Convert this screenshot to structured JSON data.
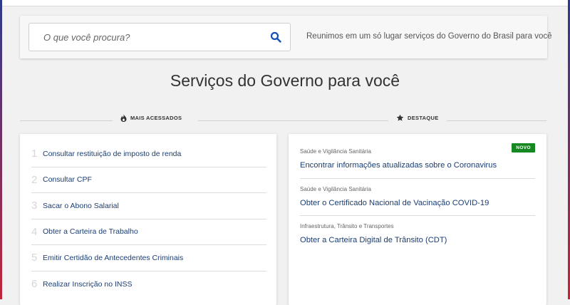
{
  "search": {
    "placeholder": "O que você procura?",
    "tagline": "Reunimos em um só lugar serviços do Governo do Brasil para você"
  },
  "main": {
    "title": "Serviços do Governo para você"
  },
  "most_accessed": {
    "heading": "MAIS ACESSADOS",
    "icon": "flame-icon",
    "items": [
      {
        "rank": "1",
        "label": "Consultar restituição de imposto de renda"
      },
      {
        "rank": "2",
        "label": "Consultar CPF"
      },
      {
        "rank": "3",
        "label": "Sacar o Abono Salarial"
      },
      {
        "rank": "4",
        "label": "Obter a Carteira de Trabalho"
      },
      {
        "rank": "5",
        "label": "Emitir Certidão de Antecedentes Criminais"
      },
      {
        "rank": "6",
        "label": "Realizar Inscrição no INSS"
      }
    ]
  },
  "highlights": {
    "heading": "DESTAQUE",
    "icon": "star-icon",
    "items": [
      {
        "category": "Saúde e Vigilância Sanitária",
        "title": "Encontrar informações atualizadas sobre o Coronavirus",
        "badge": "NOVO"
      },
      {
        "category": "Saúde e Vigilância Sanitária",
        "title": "Obter o Certificado Nacional de Vacinação COVID-19"
      },
      {
        "category": "Infraestrutura, Trânsito e Transportes",
        "title": "Obter a Carteira Digital de Trânsito (CDT)"
      }
    ]
  },
  "colors": {
    "link": "#1a3d73",
    "badge": "#168821",
    "search_icon": "#1351b4"
  }
}
